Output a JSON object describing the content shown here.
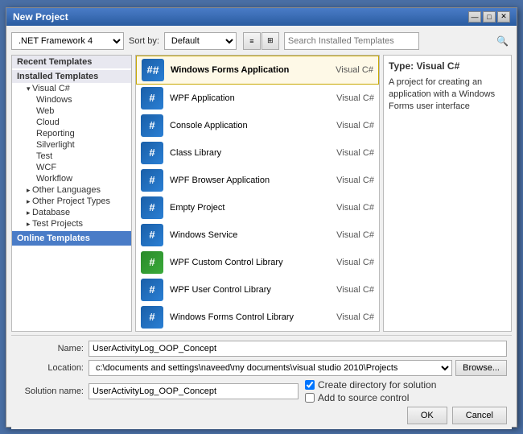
{
  "dialog": {
    "title": "New Project",
    "close_btn": "✕",
    "minimize_btn": "—",
    "maximize_btn": "□"
  },
  "toolbar": {
    "framework_label": ".NET Framework 4",
    "sort_label": "Sort by:",
    "sort_default": "Default",
    "search_placeholder": "Search Installed Templates",
    "view_list": "≡",
    "view_tile": "⊞"
  },
  "left_panel": {
    "recent_header": "Recent Templates",
    "installed_header": "Installed Templates",
    "online_header": "Online Templates",
    "tree_items": [
      {
        "label": "Visual C#",
        "level": 1,
        "expanded": true
      },
      {
        "label": "Windows",
        "level": 2
      },
      {
        "label": "Web",
        "level": 2
      },
      {
        "label": "Cloud",
        "level": 2
      },
      {
        "label": "Reporting",
        "level": 2
      },
      {
        "label": "Silverlight",
        "level": 2
      },
      {
        "label": "Test",
        "level": 2
      },
      {
        "label": "WCF",
        "level": 2
      },
      {
        "label": "Workflow",
        "level": 2
      },
      {
        "label": "Other Languages",
        "level": 1,
        "has_arrow": true
      },
      {
        "label": "Other Project Types",
        "level": 1,
        "has_arrow": true
      },
      {
        "label": "Database",
        "level": 1,
        "has_arrow": true
      },
      {
        "label": "Test Projects",
        "level": 1,
        "has_arrow": true
      }
    ]
  },
  "project_list": [
    {
      "name": "Windows Forms Application",
      "lang": "Visual C#",
      "selected": true,
      "icon_type": "cs"
    },
    {
      "name": "WPF Application",
      "lang": "Visual C#",
      "selected": false,
      "icon_type": "cs"
    },
    {
      "name": "Console Application",
      "lang": "Visual C#",
      "selected": false,
      "icon_type": "cs"
    },
    {
      "name": "Class Library",
      "lang": "Visual C#",
      "selected": false,
      "icon_type": "cs"
    },
    {
      "name": "WPF Browser Application",
      "lang": "Visual C#",
      "selected": false,
      "icon_type": "cs"
    },
    {
      "name": "Empty Project",
      "lang": "Visual C#",
      "selected": false,
      "icon_type": "cs"
    },
    {
      "name": "Windows Service",
      "lang": "Visual C#",
      "selected": false,
      "icon_type": "cs"
    },
    {
      "name": "WPF Custom Control Library",
      "lang": "Visual C#",
      "selected": false,
      "icon_type": "cs_green"
    },
    {
      "name": "WPF User Control Library",
      "lang": "Visual C#",
      "selected": false,
      "icon_type": "cs"
    },
    {
      "name": "Windows Forms Control Library",
      "lang": "Visual C#",
      "selected": false,
      "icon_type": "cs"
    }
  ],
  "right_panel": {
    "type_label": "Type: Visual C#",
    "description": "A project for creating an application with a Windows Forms user interface"
  },
  "bottom": {
    "name_label": "Name:",
    "name_value": "UserActivityLog_OOP_Concept",
    "location_label": "Location:",
    "location_value": "c:\\documents and settings\\naveed\\my documents\\visual studio 2010\\Projects",
    "solution_label": "Solution name:",
    "solution_value": "UserActivityLog_OOP_Concept",
    "browse_label": "Browse...",
    "create_dir_label": "Create directory for solution",
    "add_source_label": "Add to source control",
    "ok_label": "OK",
    "cancel_label": "Cancel"
  },
  "colors": {
    "accent": "#4a7cc7",
    "selected_bg": "#fef9e7"
  }
}
